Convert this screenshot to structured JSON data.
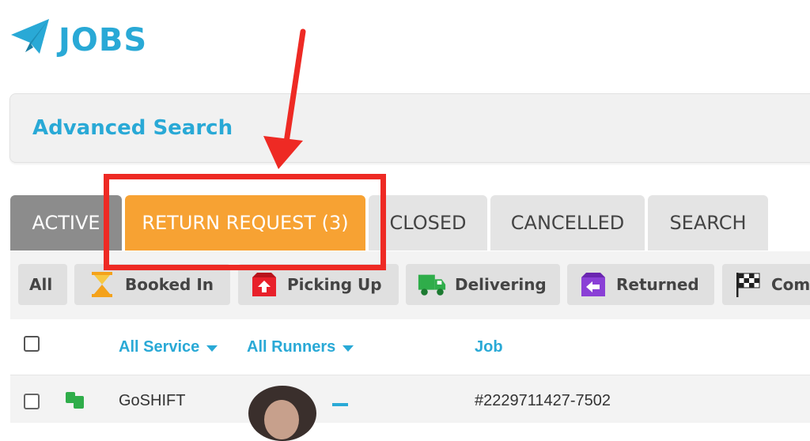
{
  "header": {
    "title": "JOBS",
    "logo_icon": "paper-plane-icon"
  },
  "advanced_search": {
    "label": "Advanced Search"
  },
  "tabs": [
    {
      "label": "ACTIVE"
    },
    {
      "label": "RETURN REQUEST (3)"
    },
    {
      "label": "CLOSED"
    },
    {
      "label": "CANCELLED"
    },
    {
      "label": "SEARCH"
    }
  ],
  "filters": [
    {
      "label": "All"
    },
    {
      "label": "Booked In",
      "icon": "hourglass-icon"
    },
    {
      "label": "Picking Up",
      "icon": "box-up-arrow-icon"
    },
    {
      "label": "Delivering",
      "icon": "truck-icon"
    },
    {
      "label": "Returned",
      "icon": "box-left-arrow-icon"
    },
    {
      "label": "Com",
      "icon": "checkered-flag-icon"
    }
  ],
  "table": {
    "columns": {
      "service": "All Service",
      "runners": "All Runners",
      "job": "Job"
    },
    "rows": [
      {
        "service": "GoSHIFT",
        "job": "#2229711427-7502"
      }
    ]
  },
  "colors": {
    "accent": "#29a9d6",
    "active_tab": "#8c8c8c",
    "return_tab": "#f7a233",
    "annotation": "#ee2a24"
  }
}
